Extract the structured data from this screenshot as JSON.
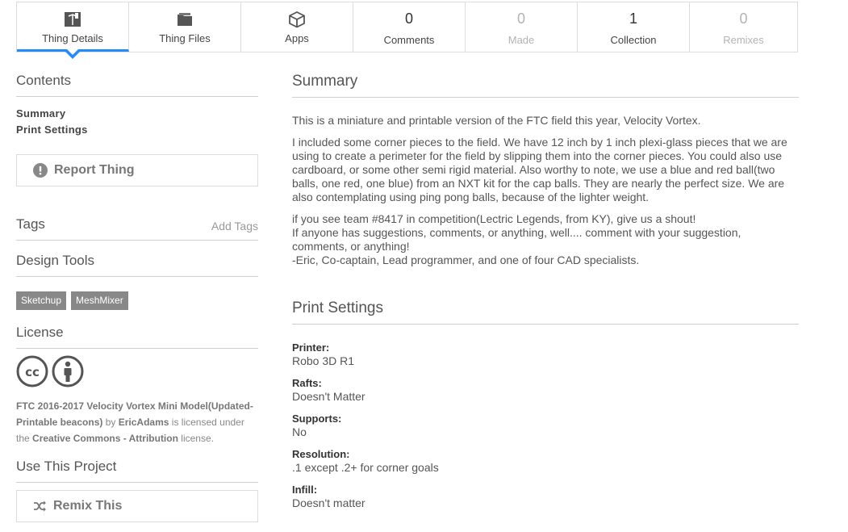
{
  "tabs": [
    {
      "label": "Thing Details",
      "icon": "thing-details-icon",
      "active": true
    },
    {
      "label": "Thing Files",
      "icon": "folder-icon"
    },
    {
      "label": "Apps",
      "icon": "cube-icon"
    },
    {
      "count": "0",
      "label": "Comments"
    },
    {
      "count": "0",
      "label": "Made",
      "muted": true
    },
    {
      "count": "1",
      "label": "Collection"
    },
    {
      "count": "0",
      "label": "Remixes",
      "muted": true
    }
  ],
  "sidebar": {
    "contents_title": "Contents",
    "contents_links": [
      "Summary",
      "Print Settings"
    ],
    "report_label": "Report Thing",
    "tags_title": "Tags",
    "add_tags_label": "Add Tags",
    "design_tools_title": "Design Tools",
    "design_tools": [
      "Sketchup",
      "MeshMixer"
    ],
    "license_title": "License",
    "license_icons": [
      "cc-icon",
      "attribution-icon"
    ],
    "license_text": {
      "thing_name": "FTC 2016-2017 Velocity Vortex Mini Model(Updated-Printable beacons)",
      "by": "by",
      "author": "EricAdams",
      "licensed_under": "is licensed under the",
      "license_name": "Creative Commons - Attribution",
      "suffix": "license."
    },
    "use_title": "Use This Project",
    "remix_label": "Remix This"
  },
  "summary": {
    "title": "Summary",
    "p1": "This is a miniature and printable version of the FTC field this year, Velocity Vortex.",
    "p2": "I included some corner pieces to the field. We have 12 inch by 1 inch plexi-glass pieces that we are using to create a perimeter for the field by slipping them into the corner pieces. You could also use cardboard, or some other semi rigid material. Also worthy to note, we use a blue and red ball(two balls, one red, one blue) from an NXT kit for the cap balls. They are nearly the perfect size. We are also contemplating using ping pong balls, because of the lighter weight.",
    "p3_line1": "if you see team #8417 in competition(Lectric Legends, from KY), give us a shout!",
    "p3_line2": "If anyone has suggestions, comments, or anything, well.... comment with your suggestion, comments, or anything!",
    "p3_line3": "-Eric, Co-captain, Lead programmer, and one of four CAD specialists."
  },
  "print_settings": {
    "title": "Print Settings",
    "items": [
      {
        "label": "Printer:",
        "value": "Robo 3D R1"
      },
      {
        "label": "Rafts:",
        "value": "Doesn't Matter"
      },
      {
        "label": "Supports:",
        "value": "No"
      },
      {
        "label": "Resolution:",
        "value": ".1 except .2+ for corner goals"
      },
      {
        "label": "Infill:",
        "value": "Doesn't matter"
      }
    ]
  },
  "colors": {
    "accent": "#248bfb",
    "tag_bg": "#888888"
  }
}
